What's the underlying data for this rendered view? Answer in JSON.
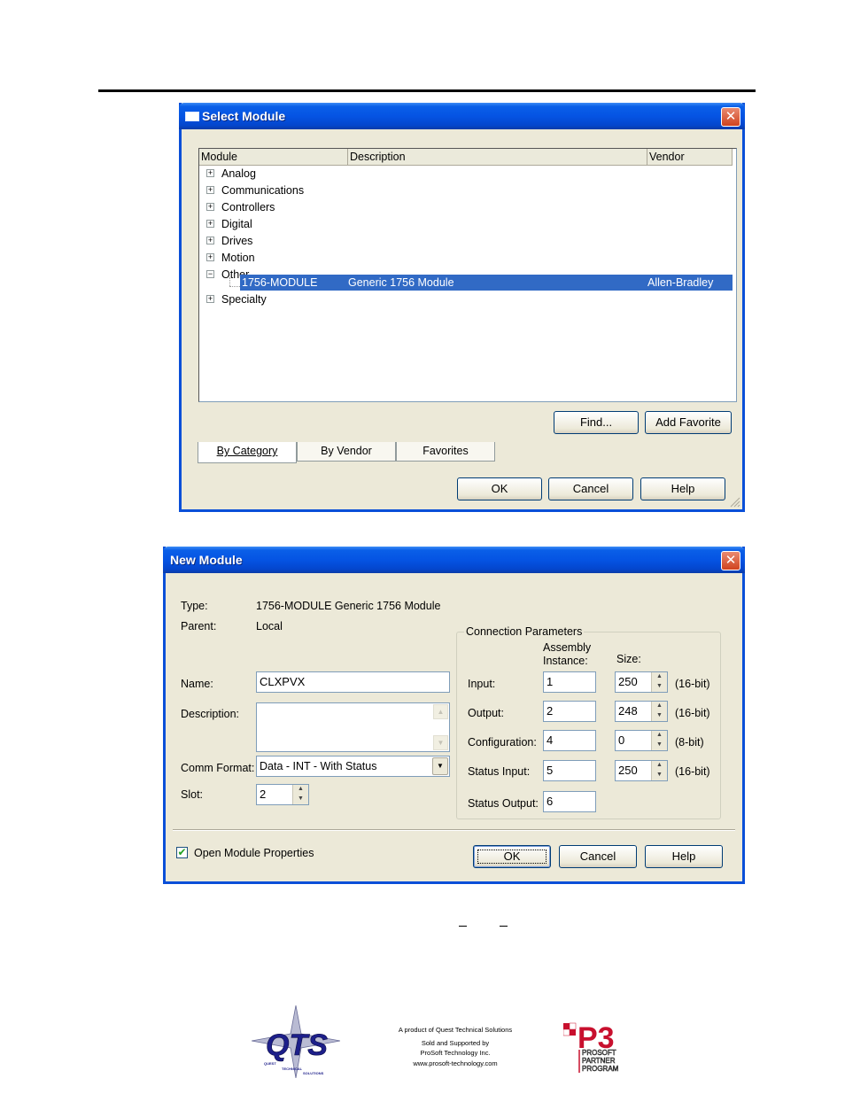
{
  "select_module": {
    "title": "Select Module",
    "columns": [
      "Module",
      "Description",
      "Vendor"
    ],
    "tree": [
      {
        "label": "Analog",
        "expander": "+"
      },
      {
        "label": "Communications",
        "expander": "+"
      },
      {
        "label": "Controllers",
        "expander": "+"
      },
      {
        "label": "Digital",
        "expander": "+"
      },
      {
        "label": "Drives",
        "expander": "+"
      },
      {
        "label": "Motion",
        "expander": "+"
      },
      {
        "label": "Other",
        "expander": "−"
      },
      {
        "label": "Specialty",
        "expander": "+"
      }
    ],
    "selected_item": {
      "module": "1756-MODULE",
      "description": "Generic 1756 Module",
      "vendor": "Allen-Bradley"
    },
    "find_button": "Find...",
    "add_favorite_button": "Add Favorite",
    "tabs": [
      "By Category",
      "By Vendor",
      "Favorites"
    ],
    "ok_button": "OK",
    "cancel_button": "Cancel",
    "help_button": "Help"
  },
  "new_module": {
    "title": "New Module",
    "type_label": "Type:",
    "type_value": "1756-MODULE Generic 1756 Module",
    "parent_label": "Parent:",
    "parent_value": "Local",
    "name_label": "Name:",
    "name_value": "CLXPVX",
    "description_label": "Description:",
    "description_value": "",
    "comm_format_label": "Comm Format:",
    "comm_format_value": "Data - INT - With Status",
    "slot_label": "Slot:",
    "slot_value": "2",
    "connection": {
      "title": "Connection Parameters",
      "assembly_header_1": "Assembly",
      "assembly_header_2": "Instance:",
      "size_header": "Size:",
      "rows": [
        {
          "label": "Input:",
          "instance": "1",
          "size": "250",
          "unit": "(16-bit)"
        },
        {
          "label": "Output:",
          "instance": "2",
          "size": "248",
          "unit": "(16-bit)"
        },
        {
          "label": "Configuration:",
          "instance": "4",
          "size": "0",
          "unit": "(8-bit)"
        },
        {
          "label": "Status Input:",
          "instance": "5",
          "size": "250",
          "unit": "(16-bit)"
        },
        {
          "label": "Status Output:",
          "instance": "6"
        }
      ]
    },
    "open_properties_label": "Open Module Properties",
    "open_properties_checked": true,
    "ok_button": "OK",
    "cancel_button": "Cancel",
    "help_button": "Help"
  },
  "footer": {
    "line1": "A product of Quest Technical Solutions",
    "line2": "Sold and Supported by",
    "line3": "ProSoft Technology Inc.",
    "line4": "www.prosoft-technology.com",
    "qts_letters": "QTS",
    "qts_words": [
      "QUEST",
      "TECHNICAL",
      "SOLUTIONS"
    ],
    "p3_mark": "P3",
    "p3_words": [
      "PROSOFT",
      "PARTNER",
      "PROGRAM"
    ]
  },
  "icons": {
    "close": "close-icon",
    "checkmark": "checkmark-icon",
    "dropdown": "chevron-down-icon"
  }
}
